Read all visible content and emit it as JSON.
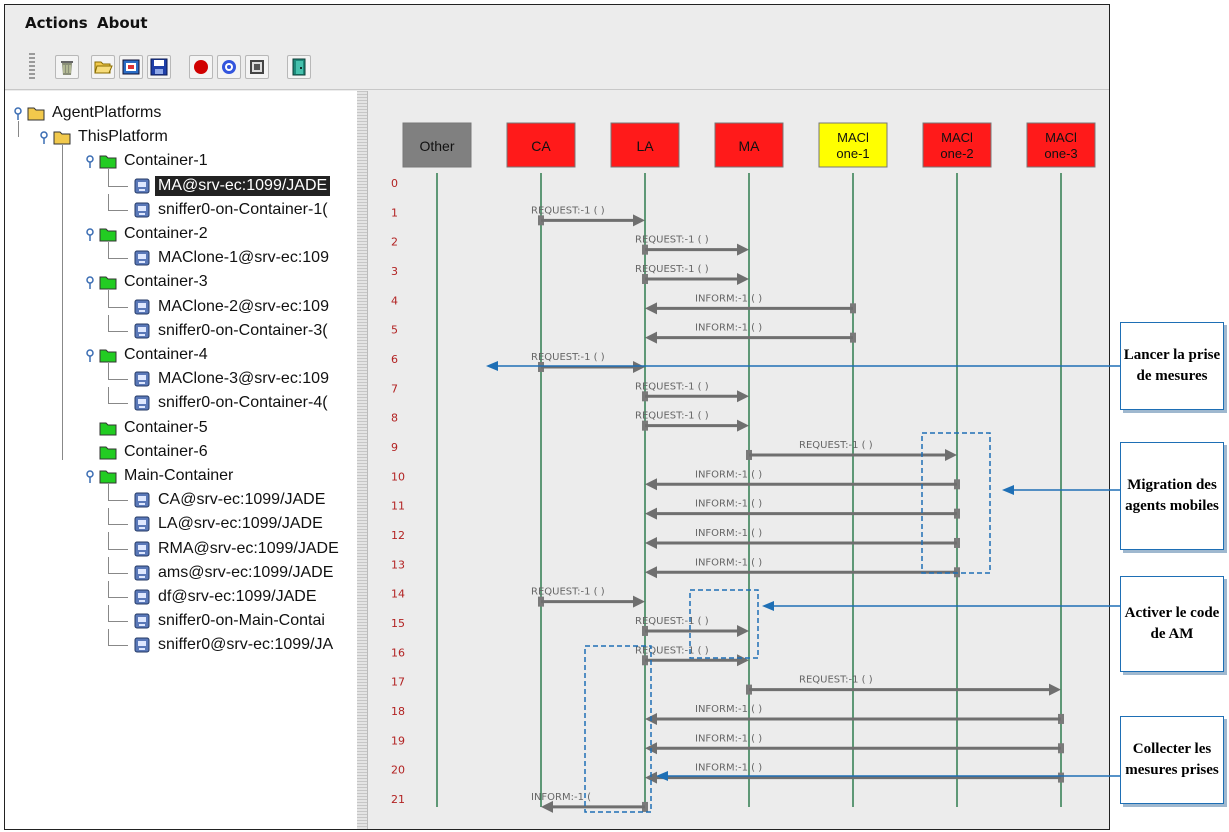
{
  "menu": {
    "actions_label": "Actions",
    "about_label": "About"
  },
  "toolbar": {
    "buttons": [
      {
        "icon": "trash-icon"
      },
      {
        "icon": "open-folder-icon"
      },
      {
        "icon": "open-snapshot-icon"
      },
      {
        "icon": "save-icon"
      },
      {
        "icon": "record-icon"
      },
      {
        "icon": "filter-icon"
      },
      {
        "icon": "snapshot-icon"
      },
      {
        "icon": "exit-door-icon"
      }
    ]
  },
  "tree": {
    "root": "AgentPlatforms",
    "platform": "ThisPlatform",
    "nodes": [
      {
        "type": "container",
        "label": "Container-1"
      },
      {
        "type": "agent",
        "label": "MA@srv-ec:1099/JADE",
        "selected": true
      },
      {
        "type": "agent",
        "label": "sniffer0-on-Container-1("
      },
      {
        "type": "container",
        "label": "Container-2"
      },
      {
        "type": "agent",
        "label": "MAClone-1@srv-ec:109"
      },
      {
        "type": "container",
        "label": "Container-3"
      },
      {
        "type": "agent",
        "label": "MAClone-2@srv-ec:109"
      },
      {
        "type": "agent",
        "label": "sniffer0-on-Container-3("
      },
      {
        "type": "container",
        "label": "Container-4"
      },
      {
        "type": "agent",
        "label": "MAClone-3@srv-ec:109"
      },
      {
        "type": "agent",
        "label": "sniffer0-on-Container-4("
      },
      {
        "type": "container",
        "label": "Container-5"
      },
      {
        "type": "container",
        "label": "Container-6"
      },
      {
        "type": "container",
        "label": "Main-Container"
      },
      {
        "type": "agent",
        "label": "CA@srv-ec:1099/JADE"
      },
      {
        "type": "agent",
        "label": "LA@srv-ec:1099/JADE"
      },
      {
        "type": "agent",
        "label": "RMA@srv-ec:1099/JADE"
      },
      {
        "type": "agent",
        "label": "ams@srv-ec:1099/JADE"
      },
      {
        "type": "agent",
        "label": "df@srv-ec:1099/JADE"
      },
      {
        "type": "agent",
        "label": "sniffer0-on-Main-Contai"
      },
      {
        "type": "agent",
        "label": "sniffer0@srv-ec:1099/JA"
      }
    ]
  },
  "sniffer": {
    "agents": [
      {
        "line1": "Other",
        "line2": "",
        "color": "#808080",
        "text_color": "#111111"
      },
      {
        "line1": "CA",
        "line2": "",
        "color": "#ff1a1a",
        "text_color": "#111111"
      },
      {
        "line1": "LA",
        "line2": "",
        "color": "#ff1a1a",
        "text_color": "#111111"
      },
      {
        "line1": "MA",
        "line2": "",
        "color": "#ff1a1a",
        "text_color": "#111111"
      },
      {
        "line1": "MACl",
        "line2": "one-1",
        "color": "#ffff00",
        "text_color": "#111111"
      },
      {
        "line1": "MACl",
        "line2": "one-2",
        "color": "#ff1a1a",
        "text_color": "#111111"
      },
      {
        "line1": "MACl",
        "line2": "one-3",
        "color": "#ff1a1a",
        "text_color": "#111111"
      }
    ],
    "row_numbers": [
      "0",
      "1",
      "2",
      "3",
      "4",
      "5",
      "6",
      "7",
      "8",
      "9",
      "10",
      "11",
      "12",
      "13",
      "14",
      "15",
      "16",
      "17",
      "18",
      "19",
      "20",
      "21"
    ],
    "messages": [
      {
        "row": 1,
        "from": 1,
        "to": 2,
        "label": "REQUEST:-1 (      )"
      },
      {
        "row": 2,
        "from": 2,
        "to": 3,
        "label": "REQUEST:-1 (      )"
      },
      {
        "row": 3,
        "from": 2,
        "to": 3,
        "label": "REQUEST:-1 (      )"
      },
      {
        "row": 4,
        "from": 4,
        "to": 2,
        "label": "INFORM:-1 (      )"
      },
      {
        "row": 5,
        "from": 4,
        "to": 2,
        "label": "INFORM:-1 (      )"
      },
      {
        "row": 6,
        "from": 1,
        "to": 2,
        "label": "REQUEST:-1 (      )"
      },
      {
        "row": 7,
        "from": 2,
        "to": 3,
        "label": "REQUEST:-1 (      )"
      },
      {
        "row": 8,
        "from": 2,
        "to": 3,
        "label": "REQUEST:-1 (      )"
      },
      {
        "row": 9,
        "from": 3,
        "to": 5,
        "label": "REQUEST:-1 (      )"
      },
      {
        "row": 10,
        "from": 5,
        "to": 2,
        "label": "INFORM:-1 (      )"
      },
      {
        "row": 11,
        "from": 5,
        "to": 2,
        "label": "INFORM:-1 (      )"
      },
      {
        "row": 12,
        "from": 5,
        "to": 2,
        "label": "INFORM:-1 (      )"
      },
      {
        "row": 13,
        "from": 5,
        "to": 2,
        "label": "INFORM:-1 (      )"
      },
      {
        "row": 14,
        "from": 1,
        "to": 2,
        "label": "REQUEST:-1 (      )"
      },
      {
        "row": 15,
        "from": 2,
        "to": 3,
        "label": "REQUEST:-1 (      )"
      },
      {
        "row": 16,
        "from": 2,
        "to": 3,
        "label": "REQUEST:-1 (      )"
      },
      {
        "row": 17,
        "from": 3,
        "to": 6,
        "label": "REQUEST:-1 (      )"
      },
      {
        "row": 18,
        "from": 6,
        "to": 2,
        "label": "INFORM:-1 (      )"
      },
      {
        "row": 19,
        "from": 6,
        "to": 2,
        "label": "INFORM:-1 (      )"
      },
      {
        "row": 20,
        "from": 6,
        "to": 2,
        "label": "INFORM:-1 (      )"
      },
      {
        "row": 21,
        "from": 2,
        "to": 1,
        "label": "INFORM:-1 (  "
      }
    ]
  },
  "annotations": [
    {
      "text": "Lancer la prise de mesures"
    },
    {
      "text": "Migration des agents mobiles"
    },
    {
      "text": "Activer le code de AM"
    },
    {
      "text": "Collecter les mesures prises"
    }
  ],
  "colors": {
    "lifeline": "#2e7d4f",
    "arrow": "#6f6f6f",
    "row_number": "#b22222",
    "annotation_blue": "#1e6fb5"
  }
}
